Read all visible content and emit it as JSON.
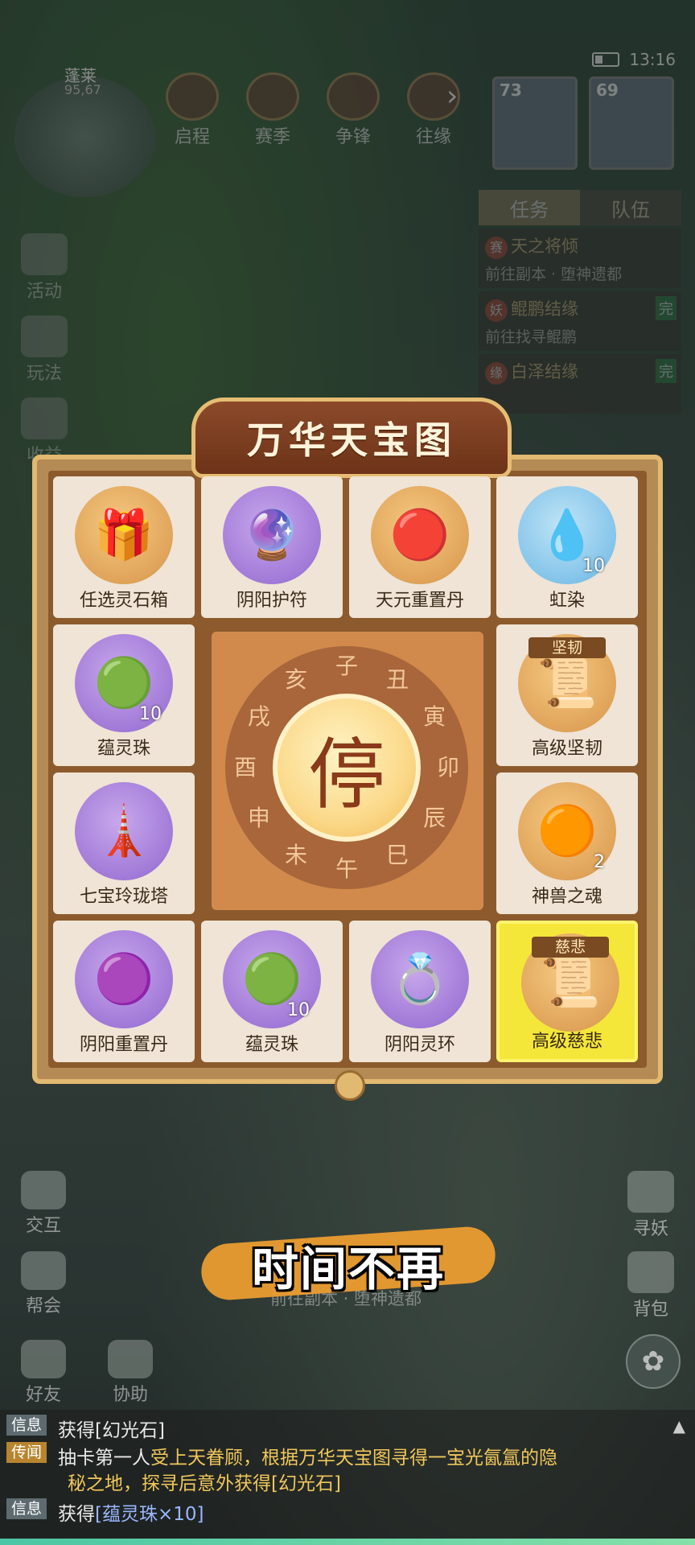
{
  "status": {
    "time": "13:16"
  },
  "map": {
    "zone": "蓬莱",
    "coord": "95,67"
  },
  "topnav": [
    {
      "label": "启程",
      "icon": "journey-icon"
    },
    {
      "label": "赛季",
      "icon": "season-icon"
    },
    {
      "label": "争锋",
      "icon": "contest-icon"
    },
    {
      "label": "往缘",
      "icon": "fate-icon"
    }
  ],
  "team": [
    {
      "level": "73"
    },
    {
      "level": "69"
    }
  ],
  "side_left": [
    "活动",
    "玩法",
    "收益"
  ],
  "tasks": {
    "tabs": [
      "任务",
      "队伍"
    ],
    "items": [
      {
        "tag": "赛",
        "title": "天之将倾",
        "desc": "前往副本 · 堕神遗都",
        "done": ""
      },
      {
        "tag": "妖",
        "title": "鲲鹏结缘",
        "desc": "前往找寻鲲鹏",
        "done": "完"
      },
      {
        "tag": "缘",
        "title": "白泽结缘",
        "desc": "",
        "done": "完"
      }
    ]
  },
  "board": {
    "title": "万华天宝图",
    "stop_label": "停",
    "dial_chars": [
      "子",
      "丑",
      "寅",
      "卯",
      "辰",
      "巳",
      "午",
      "未",
      "申",
      "酉",
      "戌",
      "亥"
    ],
    "items": [
      {
        "name": "任选灵石箱",
        "qty": "",
        "orb": "gold",
        "art": "🎁",
        "badge": ""
      },
      {
        "name": "阴阳护符",
        "qty": "",
        "orb": "purple",
        "art": "🔮",
        "badge": ""
      },
      {
        "name": "天元重置丹",
        "qty": "",
        "orb": "gold",
        "art": "🔴",
        "badge": ""
      },
      {
        "name": "虹染",
        "qty": "10",
        "orb": "blue",
        "art": "💧",
        "badge": ""
      },
      {
        "name": "蕴灵珠",
        "qty": "10",
        "orb": "purple",
        "art": "🟢",
        "badge": ""
      },
      {
        "name": "高级坚韧",
        "qty": "",
        "orb": "gold",
        "art": "📜",
        "badge": "坚韧"
      },
      {
        "name": "七宝玲珑塔",
        "qty": "",
        "orb": "purple",
        "art": "🗼",
        "badge": ""
      },
      {
        "name": "神兽之魂",
        "qty": "2",
        "orb": "gold",
        "art": "🟠",
        "badge": ""
      },
      {
        "name": "阴阳重置丹",
        "qty": "",
        "orb": "purple",
        "art": "🟣",
        "badge": ""
      },
      {
        "name": "蕴灵珠",
        "qty": "10",
        "orb": "purple",
        "art": "🟢",
        "badge": ""
      },
      {
        "name": "阴阳灵环",
        "qty": "",
        "orb": "purple",
        "art": "💍",
        "badge": ""
      },
      {
        "name": "高级慈悲",
        "qty": "",
        "orb": "gold",
        "art": "📜",
        "badge": "慈悲"
      }
    ],
    "selected_index": 11
  },
  "subtitle": "时间不再",
  "faded_quest": "前往副本 · 堕神遗都",
  "bottom_left": [
    "交互",
    "帮会",
    "好友",
    "协助"
  ],
  "bottom_right": [
    "寻妖",
    "背包"
  ],
  "chat": [
    {
      "channel": "信息",
      "text": "获得[幻光石]"
    },
    {
      "channel": "传闻",
      "text_a": "抽卡第一人",
      "text_b": "受上天眷顾，根据万华天宝图寻得一宝光氤氲的隐",
      "text_c": "秘之地，探寻后意外获得[幻光石]"
    },
    {
      "channel": "信息",
      "text_a": "获得",
      "text_b": "[蕴灵珠×10]"
    }
  ]
}
